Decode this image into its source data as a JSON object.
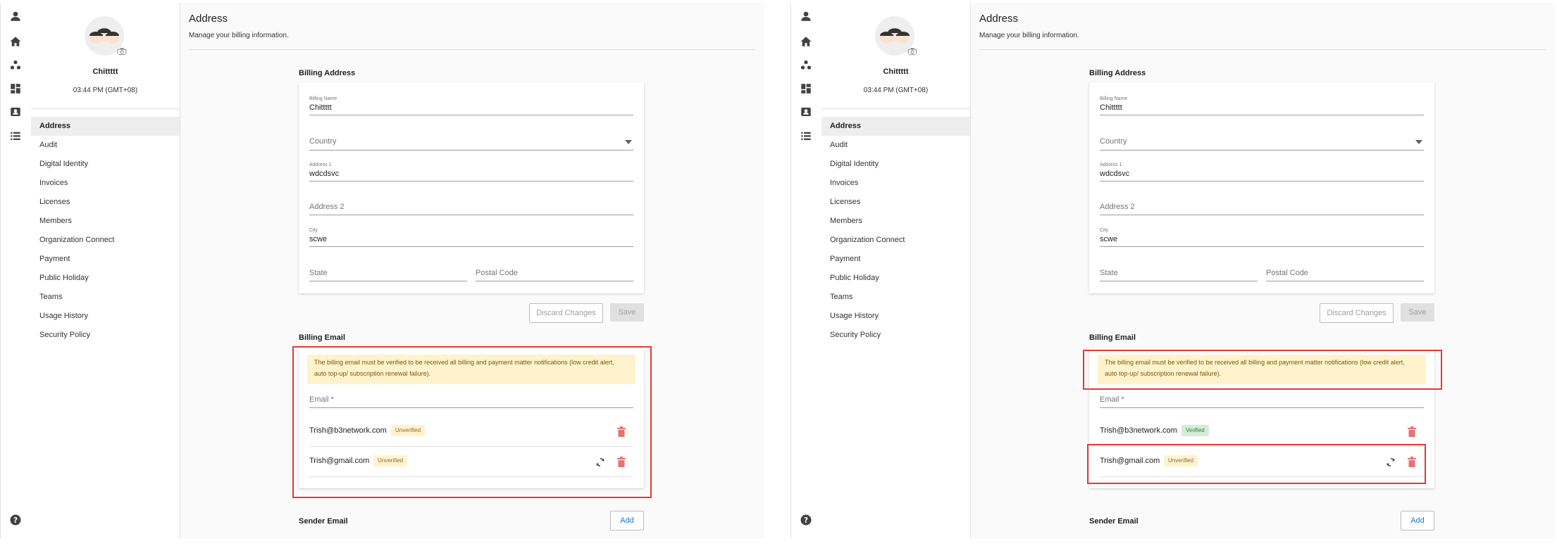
{
  "user": {
    "name": "Chittttt",
    "time": "03:44 PM (GMT+08)"
  },
  "nav": [
    "Address",
    "Audit",
    "Digital Identity",
    "Invoices",
    "Licenses",
    "Members",
    "Organization Connect",
    "Payment",
    "Public Holiday",
    "Teams",
    "Usage History",
    "Security Policy"
  ],
  "page": {
    "title": "Address",
    "subtitle": "Manage your billing information."
  },
  "billing_address": {
    "heading": "Billing Address",
    "name_label": "Billing Name",
    "name_value": "Chittttt",
    "country_placeholder": "Country",
    "address1_label": "Address 1",
    "address1_value": "wdcdsvc",
    "address2_placeholder": "Address 2",
    "city_label": "City",
    "city_value": "scwe",
    "state_placeholder": "State",
    "postal_placeholder": "Postal Code",
    "discard_label": "Discard Changes",
    "save_label": "Save"
  },
  "billing_email": {
    "heading": "Billing Email",
    "warning_line1": "The billing email must be verified to be received all billing and payment matter notifications (low credit alert,",
    "warning_line2": "auto top-up/ subscription renewal failure).",
    "email_placeholder": "Email *"
  },
  "panels": [
    {
      "emails": [
        {
          "address": "Trish@b3network.com",
          "status": "Unverified"
        },
        {
          "address": "Trish@gmail.com",
          "status": "Unverified"
        }
      ]
    },
    {
      "emails": [
        {
          "address": "Trish@b3network.com",
          "status": "Verified"
        },
        {
          "address": "Trish@gmail.com",
          "status": "Unverified"
        }
      ]
    }
  ],
  "sender_email": {
    "heading": "Sender Email",
    "add_label": "Add"
  },
  "colors": {
    "accent": "#1976d2",
    "highlight": "#e53935",
    "unverified_bg": "#fff3cd",
    "verified_bg": "#d4edda",
    "trash": "#e57373"
  }
}
